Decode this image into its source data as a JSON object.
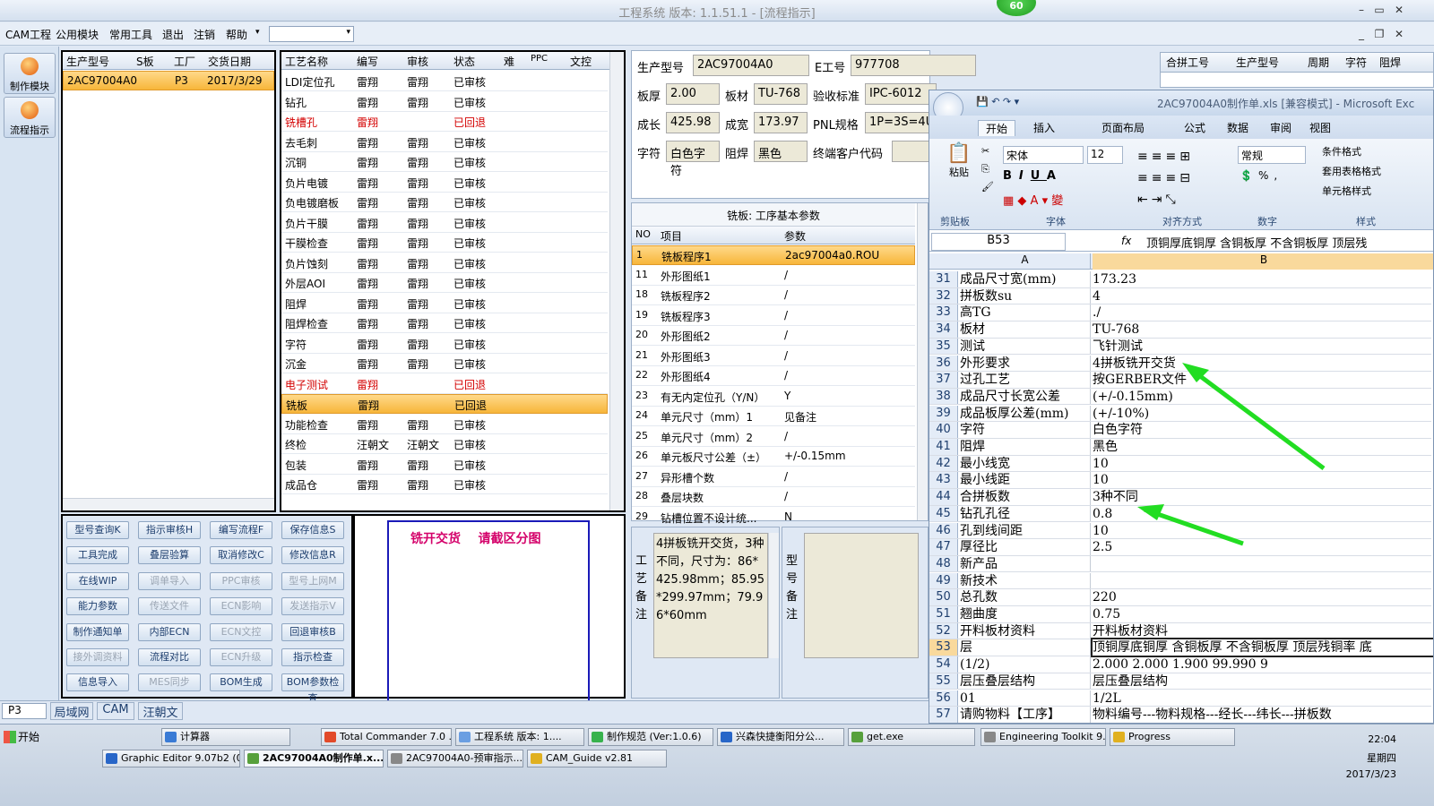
{
  "window": {
    "title": "工程系统   版本: 1.1.51.1 - [流程指示]",
    "badge": "60"
  },
  "menu": [
    "CAM工程",
    "公用模块",
    "常用工具",
    "退出",
    "注销",
    "帮助"
  ],
  "sidebar": [
    {
      "label": "制作模块"
    },
    {
      "label": "流程指示"
    }
  ],
  "orders": {
    "headers": [
      "生产型号",
      "S板",
      "工厂",
      "交货日期"
    ],
    "rows": [
      [
        "2AC97004A0",
        "",
        "P3",
        "2017/3/29"
      ]
    ]
  },
  "process": {
    "headers": [
      "工艺名称",
      "编写",
      "审核",
      "状态",
      "难",
      "PPC",
      "文控"
    ],
    "rows": [
      [
        "LDI定位孔",
        "雷翔",
        "雷翔",
        "已审核",
        ""
      ],
      [
        "钻孔",
        "雷翔",
        "雷翔",
        "已审核",
        ""
      ],
      [
        "铣槽孔",
        "雷翔",
        "",
        "已回退",
        "red"
      ],
      [
        "去毛刺",
        "雷翔",
        "雷翔",
        "已审核",
        ""
      ],
      [
        "沉铜",
        "雷翔",
        "雷翔",
        "已审核",
        ""
      ],
      [
        "负片电镀",
        "雷翔",
        "雷翔",
        "已审核",
        ""
      ],
      [
        "负电镀磨板",
        "雷翔",
        "雷翔",
        "已审核",
        ""
      ],
      [
        "负片干膜",
        "雷翔",
        "雷翔",
        "已审核",
        ""
      ],
      [
        "干膜检查",
        "雷翔",
        "雷翔",
        "已审核",
        ""
      ],
      [
        "负片蚀刻",
        "雷翔",
        "雷翔",
        "已审核",
        ""
      ],
      [
        "外层AOI",
        "雷翔",
        "雷翔",
        "已审核",
        ""
      ],
      [
        "阻焊",
        "雷翔",
        "雷翔",
        "已审核",
        ""
      ],
      [
        "阻焊检查",
        "雷翔",
        "雷翔",
        "已审核",
        ""
      ],
      [
        "字符",
        "雷翔",
        "雷翔",
        "已审核",
        ""
      ],
      [
        "沉金",
        "雷翔",
        "雷翔",
        "已审核",
        ""
      ],
      [
        "电子测试",
        "雷翔",
        "",
        "已回退",
        "red"
      ],
      [
        "铣板",
        "雷翔",
        "",
        "已回退",
        "sel"
      ],
      [
        "功能检查",
        "雷翔",
        "雷翔",
        "已审核",
        ""
      ],
      [
        "终检",
        "汪朝文",
        "汪朝文",
        "已审核",
        ""
      ],
      [
        "包装",
        "雷翔",
        "雷翔",
        "已审核",
        ""
      ],
      [
        "成品仓",
        "雷翔",
        "雷翔",
        "已审核",
        ""
      ]
    ]
  },
  "buttons": [
    [
      "型号查询K",
      "指示审核H",
      "编写流程F",
      "保存信息S"
    ],
    [
      "工具完成",
      "叠层验算",
      "取消修改C",
      "修改信息R"
    ],
    [
      "在线WIP",
      "调单导入",
      "PPC审核",
      "型号上网M"
    ],
    [
      "能力参数",
      "传送文件",
      "ECN影响",
      "发送指示V"
    ],
    [
      "制作通知单",
      "内部ECN",
      "ECN文控",
      "回退审核B"
    ],
    [
      "接外调资料",
      "流程对比",
      "ECN升级",
      "指示检查"
    ],
    [
      "信息导入",
      "MES同步",
      "BOM生成",
      "BOM参数检查"
    ]
  ],
  "buttons_disabled": [
    [
      0,
      0,
      0,
      0
    ],
    [
      0,
      0,
      0,
      0
    ],
    [
      0,
      1,
      1,
      1
    ],
    [
      0,
      1,
      1,
      1
    ],
    [
      0,
      0,
      1,
      0
    ],
    [
      1,
      0,
      1,
      0
    ],
    [
      0,
      1,
      0,
      0
    ]
  ],
  "note": "铣开交货    请截区分图",
  "info": {
    "prod_model_label": "生产型号",
    "prod_model": "2AC97004A0",
    "eno_label": "E工号",
    "eno": "977708",
    "thick_label": "板厚",
    "thick": "2.00",
    "mat_label": "板材",
    "mat": "TU-768",
    "std_label": "验收标准",
    "std": "IPC-6012",
    "len_label": "成长",
    "len": "425.98",
    "wid_label": "成宽",
    "wid": "173.97",
    "pnl_label": "PNL规格",
    "pnl": "1P=3S=4U",
    "char_label": "字符",
    "char": "白色字符",
    "mask_label": "阻焊",
    "mask": "黑色",
    "cust_label": "终端客户代码"
  },
  "right_header": [
    "合拼工号",
    "生产型号",
    "周期",
    "字符",
    "阻焊"
  ],
  "params": {
    "title": "铣板: 工序基本参数",
    "headers": [
      "NO",
      "项目",
      "参数"
    ],
    "rows": [
      [
        "1",
        "铣板程序1",
        "2ac97004a0.ROU"
      ],
      [
        "11",
        "外形图纸1",
        "/"
      ],
      [
        "18",
        "铣板程序2",
        "/"
      ],
      [
        "19",
        "铣板程序3",
        "/"
      ],
      [
        "20",
        "外形图纸2",
        "/"
      ],
      [
        "21",
        "外形图纸3",
        "/"
      ],
      [
        "22",
        "外形图纸4",
        "/"
      ],
      [
        "23",
        "有无内定位孔（Y/N）",
        "Y"
      ],
      [
        "24",
        "单元尺寸（mm）1",
        "见备注"
      ],
      [
        "25",
        "单元尺寸（mm）2",
        "/"
      ],
      [
        "26",
        "单元板尺寸公差（±）",
        "+/-0.15mm"
      ],
      [
        "27",
        "异形槽个数",
        "/"
      ],
      [
        "28",
        "叠层块数",
        "/"
      ],
      [
        "29",
        "钻槽位置不设计统...",
        "N"
      ]
    ]
  },
  "remark": {
    "label": "工艺备注",
    "text": "4拼板铣开交货，3种不同，尺寸为：86*425.98mm；85.95*299.97mm；79.96*60mm"
  },
  "model_remark_label": "型号备注",
  "statusbar": {
    "combo": "P3",
    "tabs": [
      "局域网",
      "CAM",
      "汪朝文"
    ]
  },
  "excel": {
    "title": "2AC97004A0制作单.xls [兼容模式] - Microsoft Exc",
    "tabs": [
      "开始",
      "插入",
      "页面布局",
      "公式",
      "数据",
      "审阅",
      "视图"
    ],
    "font": "宋体",
    "size": "12",
    "numfmt": "常规",
    "styles": [
      "条件格式",
      "套用表格格式",
      "单元格样式"
    ],
    "groups": [
      "剪贴板",
      "字体",
      "对齐方式",
      "数字",
      "样式"
    ],
    "paste": "粘贴",
    "namebox": "B53",
    "fx": "fx",
    "formula": "顶铜厚底铜厚  含铜板厚  不含铜板厚  顶层残",
    "colA": "A",
    "colB": "B",
    "rows": [
      [
        "31",
        "成品尺寸宽(mm)",
        "173.23"
      ],
      [
        "32",
        "拼板数su",
        "4"
      ],
      [
        "33",
        "高TG",
        "./"
      ],
      [
        "34",
        "板材",
        "TU-768"
      ],
      [
        "35",
        "测试",
        "飞针测试"
      ],
      [
        "36",
        "外形要求",
        "4拼板铣开交货"
      ],
      [
        "37",
        "过孔工艺",
        "按GERBER文件"
      ],
      [
        "38",
        "成品尺寸长宽公差",
        "(+/-0.15mm)"
      ],
      [
        "39",
        "成品板厚公差(mm)",
        "(+/-10%)"
      ],
      [
        "40",
        "字符",
        "白色字符"
      ],
      [
        "41",
        "阻焊",
        "黑色"
      ],
      [
        "42",
        "最小线宽",
        "10"
      ],
      [
        "43",
        "最小线距",
        "10"
      ],
      [
        "44",
        "合拼板数",
        "3种不同"
      ],
      [
        "45",
        "钻孔孔径",
        "0.8"
      ],
      [
        "46",
        "孔到线间距",
        "10"
      ],
      [
        "47",
        "厚径比",
        "2.5"
      ],
      [
        "48",
        "新产品",
        ""
      ],
      [
        "49",
        "新技术",
        ""
      ],
      [
        "50",
        "总孔数",
        "220"
      ],
      [
        "51",
        "翘曲度",
        "0.75"
      ],
      [
        "52",
        "开料板材资料",
        "开料板材资料"
      ],
      [
        "53",
        "层",
        "顶铜厚底铜厚  含铜板厚  不含铜板厚  顶层残铜率  底"
      ],
      [
        "54",
        "(1/2)",
        "2.000   2.000    1.900              99.990     9"
      ],
      [
        "55",
        "层压叠层结构",
        "层压叠层结构"
      ],
      [
        "56",
        "01",
        "1/2L"
      ],
      [
        "57",
        "请购物料【工序】",
        "物料编号---物料规格---经长---纬长---拼板数"
      ]
    ]
  },
  "taskbar": {
    "start": "开始",
    "row1": [
      "计算器",
      "Total Commander 7.0 ...",
      "工程系统  版本: 1....",
      "制作规范 (Ver:1.0.6)",
      "兴森快捷衡阳分公...",
      "get.exe",
      "Engineering Toolkit 9....",
      "Progress"
    ],
    "row2": [
      "Graphic Editor 9.07b2 (0...",
      "2AC97004A0制作单.x...",
      "2AC97004A0-预审指示...",
      "CAM_Guide v2.81"
    ],
    "time": "22:04",
    "weekday": "星期四",
    "date": "2017/3/23"
  },
  "colors": {
    "accent": "#f7b63a",
    "arrow": "#22dd22",
    "red": "#d40000"
  }
}
